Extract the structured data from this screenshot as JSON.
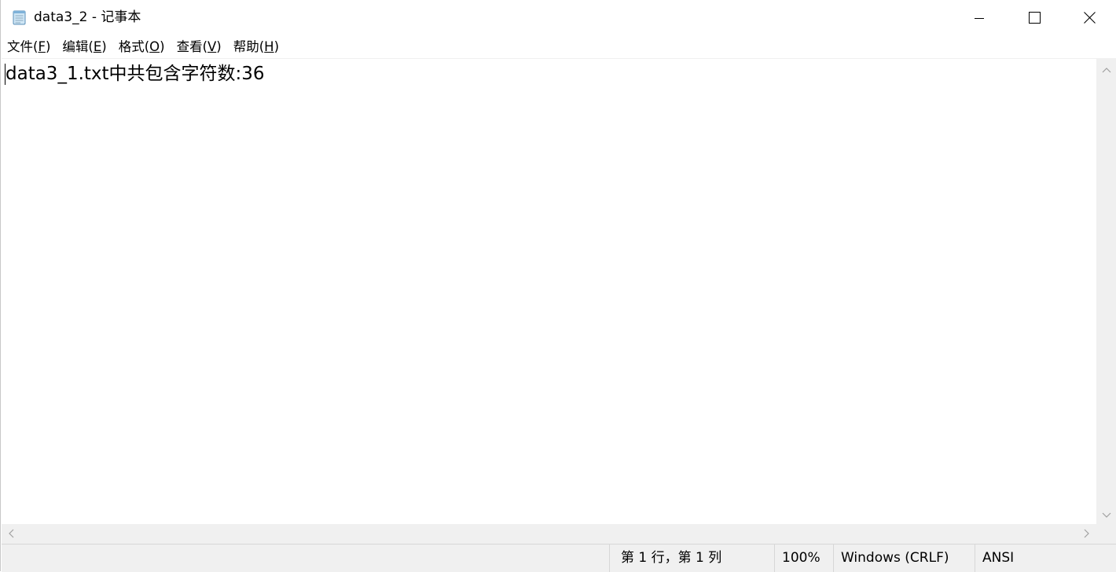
{
  "window": {
    "title": "data3_2 - 记事本",
    "icons": {
      "app": "notepad-icon",
      "minimize": "minimize-icon",
      "maximize": "maximize-icon",
      "close": "close-icon"
    }
  },
  "menu": {
    "items": [
      {
        "label": "文件(",
        "key": "F",
        "suffix": ")"
      },
      {
        "label": "编辑(",
        "key": "E",
        "suffix": ")"
      },
      {
        "label": "格式(",
        "key": "O",
        "suffix": ")"
      },
      {
        "label": "查看(",
        "key": "V",
        "suffix": ")"
      },
      {
        "label": "帮助(",
        "key": "H",
        "suffix": ")"
      }
    ]
  },
  "editor": {
    "content": "data3_1.txt中共包含字符数:36"
  },
  "scrollbars": {
    "icons": [
      "scroll-up-arrow-icon",
      "scroll-down-arrow-icon",
      "scroll-left-arrow-icon",
      "scroll-right-arrow-icon"
    ]
  },
  "statusbar": {
    "position": "第 1 行，第 1 列",
    "zoom": "100%",
    "line_ending": "Windows (CRLF)",
    "encoding": "ANSI"
  },
  "colors": {
    "chrome_background": "#f0f0f0",
    "text": "#000000",
    "editor_background": "#ffffff"
  }
}
